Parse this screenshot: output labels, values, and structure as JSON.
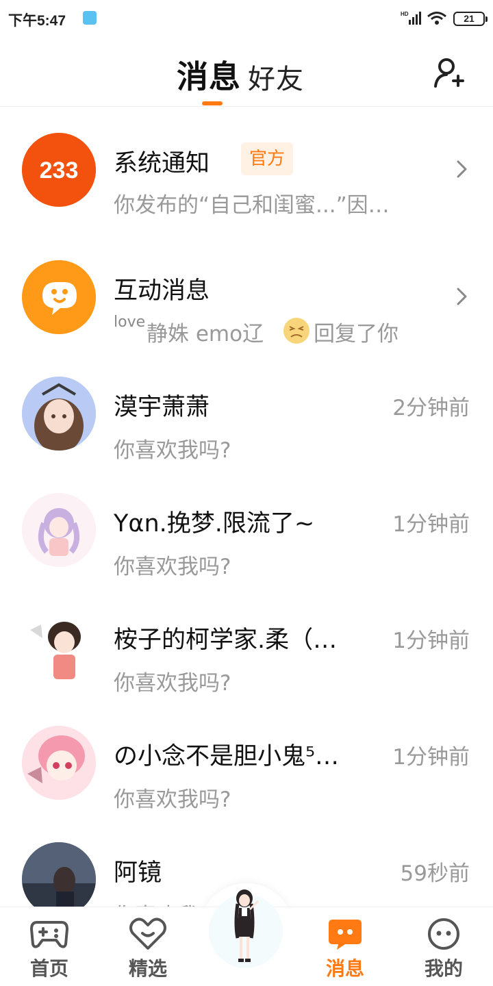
{
  "status_bar": {
    "time": "下午5:47",
    "network": "HD",
    "battery": "21"
  },
  "header": {
    "tab_messages": "消息",
    "tab_friends": "好友",
    "add_friend_icon": "add-friend-icon"
  },
  "messages": [
    {
      "title": "系统通知",
      "badge": "官方",
      "avatar_text": "233",
      "subtitle": "你发布的“自己和闺蜜...”因…",
      "icon": "chevron-right-icon"
    },
    {
      "title": "互动消息",
      "subtitle_prefix": "love",
      "subtitle": "静姝 emo辽",
      "subtitle_suffix": "回复了你",
      "icon": "chevron-right-icon"
    },
    {
      "title": "漠宇萧萧",
      "subtitle": "你喜欢我吗?",
      "time": "2分钟前"
    },
    {
      "title": "Yαn.挽梦.限流了~",
      "subtitle": "你喜欢我吗?",
      "time": "1分钟前"
    },
    {
      "title": "桉子的柯学家.柔（…",
      "subtitle": "你喜欢我吗?",
      "time": "1分钟前"
    },
    {
      "title": "の小念不是胆小鬼⁵…",
      "subtitle": "你喜欢我吗?",
      "time": "1分钟前"
    },
    {
      "title": "阿镜",
      "subtitle": "你喜欢我吗?",
      "time": "59秒前"
    }
  ],
  "bottom_nav": [
    {
      "label": "首页",
      "icon": "gamepad-icon",
      "active": false
    },
    {
      "label": "精选",
      "icon": "heart-icon",
      "active": false
    },
    {
      "label": "消息",
      "icon": "message-icon",
      "active": true
    },
    {
      "label": "我的",
      "icon": "smiley-icon",
      "active": false
    }
  ],
  "colors": {
    "accent": "#ff7a12",
    "text_secondary": "#999999",
    "badge_bg": "#fff1e4"
  }
}
